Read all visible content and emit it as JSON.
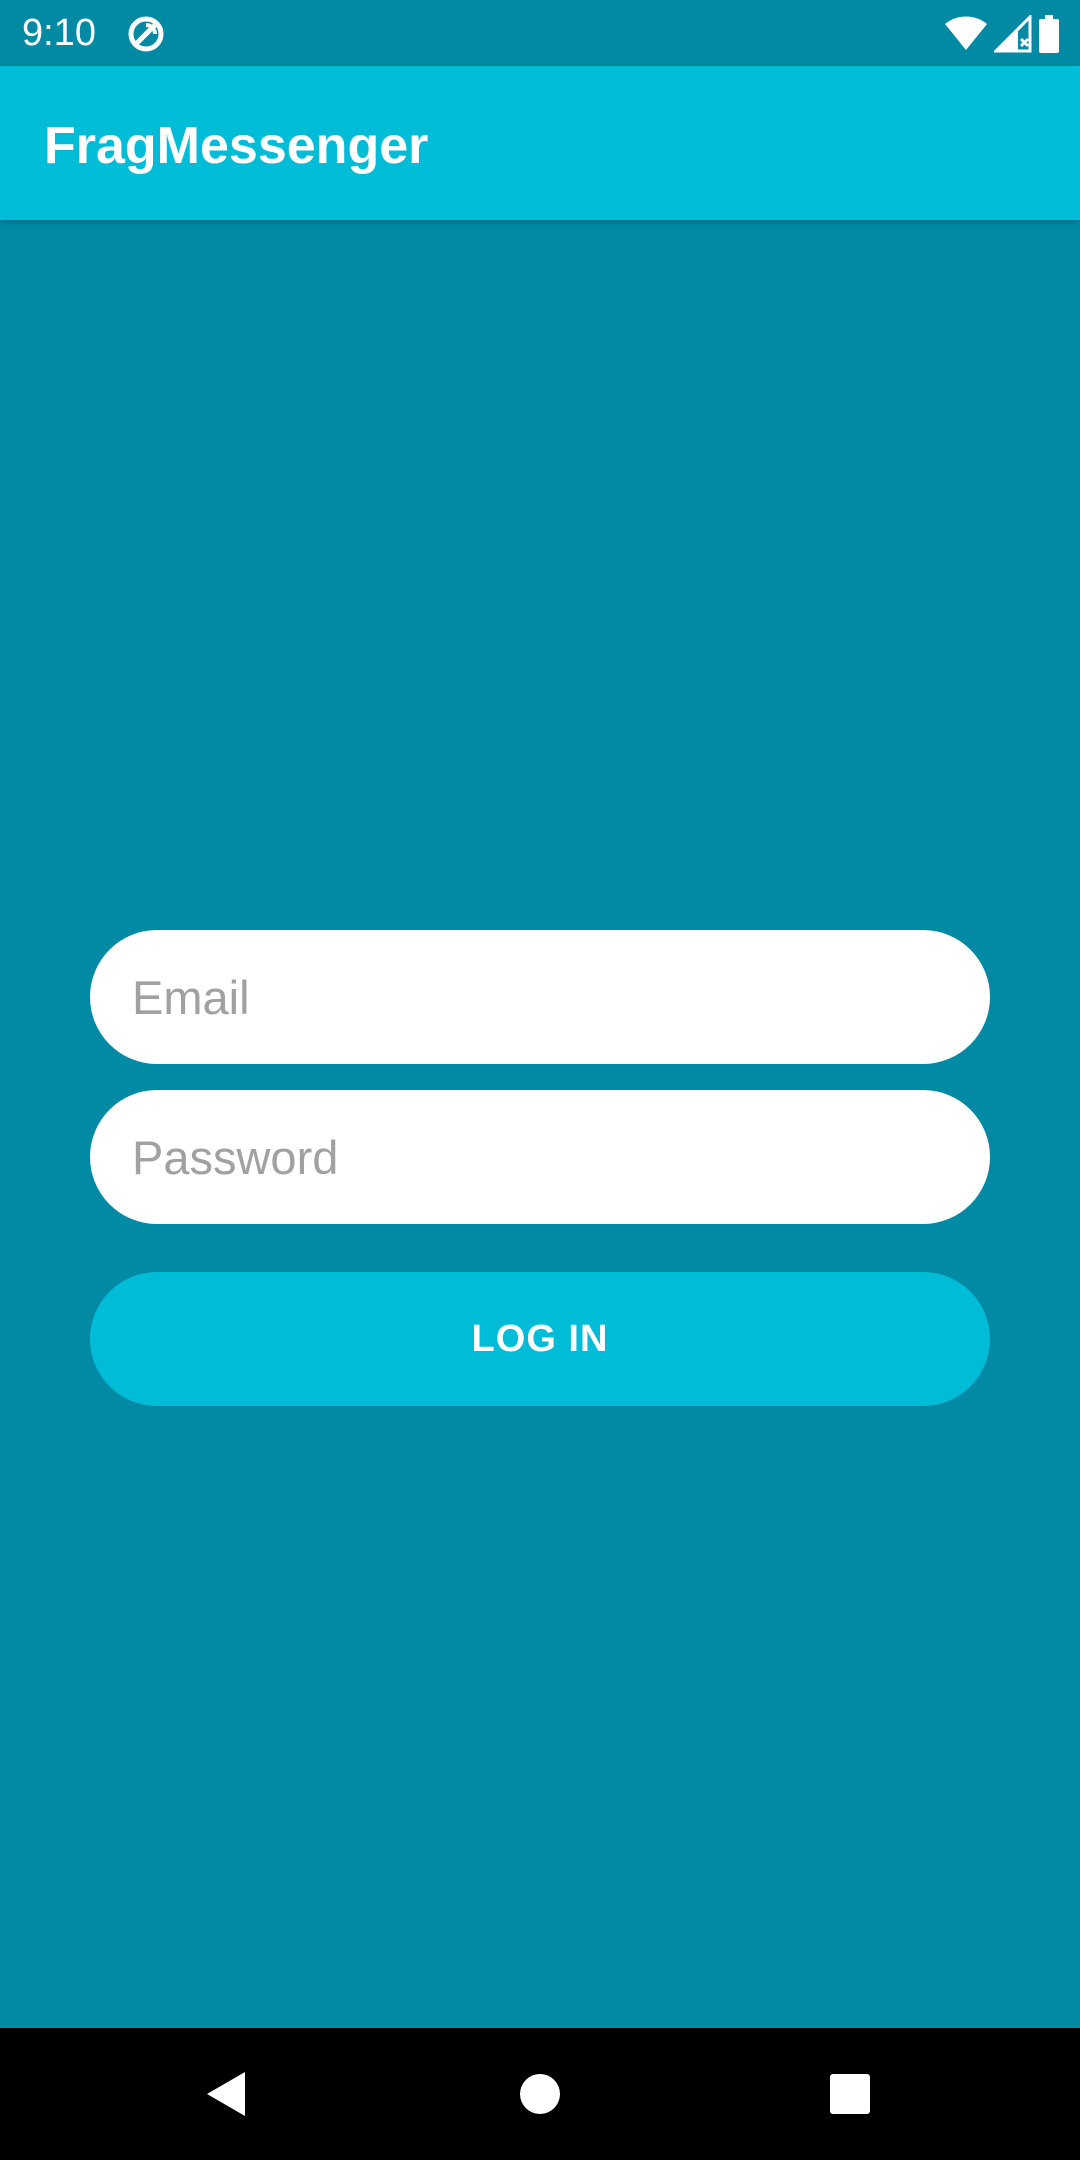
{
  "status_bar": {
    "time": "9:10",
    "icons": [
      "sync-icon",
      "wifi-icon",
      "cellular-signal-icon",
      "battery-icon"
    ]
  },
  "app_bar": {
    "title": "FragMessenger"
  },
  "login_form": {
    "email_placeholder": "Email",
    "email_value": "",
    "password_placeholder": "Password",
    "password_value": "",
    "login_label": "LOG IN"
  },
  "nav_bar": {
    "buttons": [
      "back-icon",
      "home-icon",
      "recents-icon"
    ]
  },
  "colors": {
    "background": "#028aa5",
    "accent": "#00bcd6",
    "field": "#ffffff",
    "placeholder": "#a1a1a1",
    "nav": "#000000"
  }
}
